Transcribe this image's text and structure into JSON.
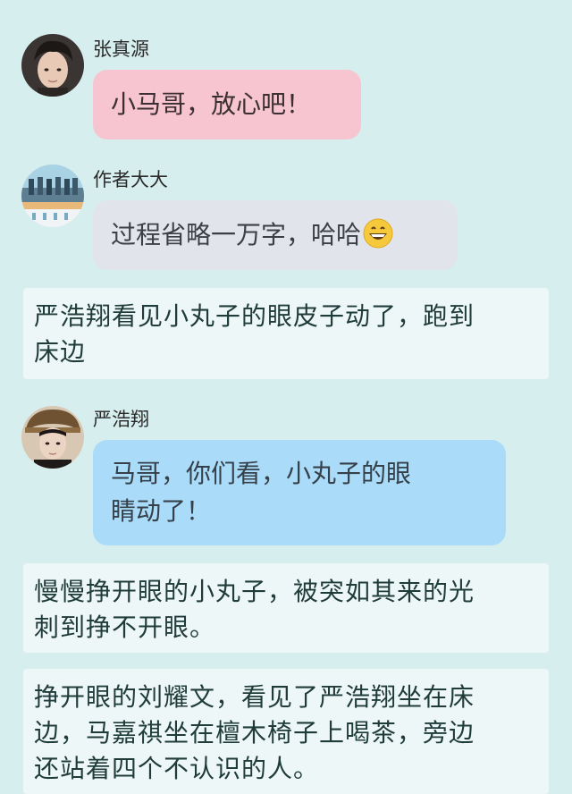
{
  "messages": [
    {
      "sender": "张真源",
      "text": "小马哥，放心吧！",
      "avatar_icon": "person-portrait-icon",
      "bubble_color": "#f7c5cf"
    },
    {
      "sender": "作者大大",
      "text": "过程省略一万字，哈哈",
      "emoji_icon": "grinning-face-icon",
      "avatar_icon": "group-photo-icon",
      "bubble_color": "#e1e4ea"
    },
    {
      "sender": "严浩翔",
      "lines": [
        "马哥，你们看，小丸子的眼",
        "睛动了！"
      ],
      "avatar_icon": "person-portrait-icon",
      "bubble_color": "#aadcf9"
    }
  ],
  "narrations": [
    {
      "lines": [
        "严浩翔看见小丸子的眼皮子动了，跑到",
        "床边"
      ]
    },
    {
      "lines": [
        "慢慢挣开眼的小丸子，被突如其来的光",
        "刺到挣不开眼。"
      ]
    },
    {
      "lines": [
        "挣开眼的刘耀文，看见了严浩翔坐在床",
        "边，马嘉祺坐在檀木椅子上喝茶，旁边",
        "还站着四个不认识的人。"
      ]
    }
  ],
  "colors": {
    "background": "#d7eeee",
    "narration_box": "#eef7f8"
  }
}
